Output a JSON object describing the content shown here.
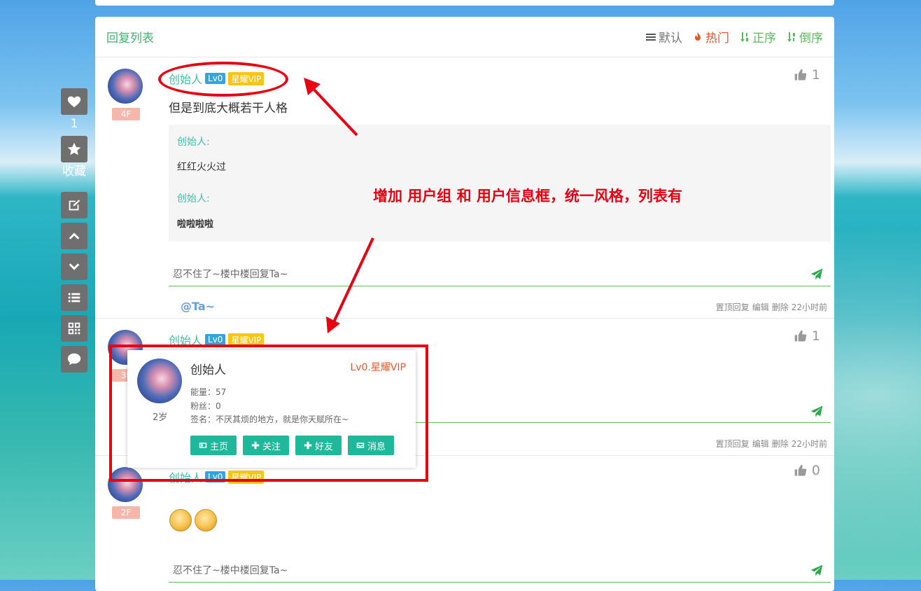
{
  "sidebar": {
    "like_count": "1",
    "collect_label": "收藏"
  },
  "header": {
    "title": "回复列表",
    "sorts": {
      "default": "默认",
      "hot": "热门",
      "asc": "正序",
      "desc": "倒序"
    }
  },
  "replies": [
    {
      "floor": "4F",
      "user": "创始人",
      "level": "Lv0",
      "vip": "星耀VIP",
      "likes": "1",
      "content": "但是到底大概若干人格",
      "quotes": [
        {
          "name": "创始人:",
          "text": "红红火火过"
        },
        {
          "name": "创始人:",
          "text": "啦啦啦啦"
        }
      ],
      "reply_placeholder": "忍不住了~楼中楼回复Ta~",
      "at_label": "@Ta~",
      "actions": {
        "top": "置顶回复",
        "edit": "编辑",
        "delete": "删除",
        "time": "22小时前"
      }
    },
    {
      "floor": "3F",
      "user": "创始人",
      "level": "Lv0",
      "vip": "星耀VIP",
      "likes": "1",
      "actions": {
        "top": "置顶回复",
        "edit": "编辑",
        "delete": "删除",
        "time": "22小时前"
      }
    },
    {
      "floor": "2F",
      "user": "创始人",
      "level": "Lv0",
      "vip": "星耀VIP",
      "likes": "0",
      "reply_placeholder": "忍不住了~楼中楼回复Ta~"
    }
  ],
  "annotation": {
    "text": "增加 用户组  和  用户信息框，统一风格，列表有"
  },
  "popup": {
    "name": "创始人",
    "level": "Lv0.星耀VIP",
    "age": "2岁",
    "energy": "能量：57",
    "fans": "粉丝：0",
    "sign": "签名：不厌其烦的地方，就是你天赋所在~",
    "buttons": {
      "home": "主页",
      "follow": "关注",
      "friend": "好友",
      "message": "消息"
    }
  }
}
